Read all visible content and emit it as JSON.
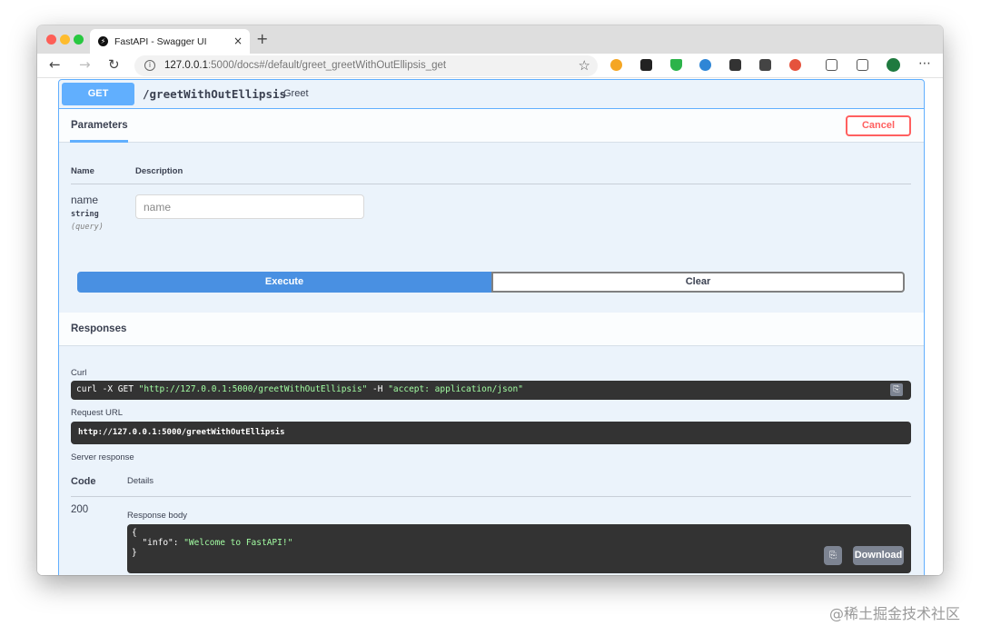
{
  "browser": {
    "tab_title": "FastAPI - Swagger UI",
    "tab_close": "×",
    "new_tab": "+",
    "url_host": "127.0.0.1",
    "url_rest": ":5000/docs#/default/greet_greetWithOutEllipsis_get",
    "nav": {
      "back": "←",
      "forward": "→",
      "reload": "↻"
    },
    "info_glyph": "i",
    "star": "☆",
    "menu": "⋯",
    "extensions": [
      {
        "name": "ext-orange-icon",
        "color": "#f5a623"
      },
      {
        "name": "ext-dark-icon",
        "color": "#222222"
      },
      {
        "name": "ext-shield-icon",
        "color": "#2cb34a"
      },
      {
        "name": "ext-blue-icon",
        "color": "#2f86d6"
      },
      {
        "name": "ext-notion-icon",
        "color": "#333333"
      },
      {
        "name": "ext-box-icon",
        "color": "#444444"
      },
      {
        "name": "ext-colorful-icon",
        "color": "#e5533d"
      },
      {
        "name": "favorites-icon",
        "color": "#555555"
      },
      {
        "name": "collections-icon",
        "color": "#555555"
      },
      {
        "name": "profile-avatar-icon",
        "color": "#1f7a3f"
      }
    ]
  },
  "operation": {
    "method": "GET",
    "path": "/greetWithOutEllipsis",
    "summary": "Greet"
  },
  "parameters": {
    "tab_label": "Parameters",
    "cancel_label": "Cancel",
    "col_name": "Name",
    "col_description": "Description",
    "param": {
      "name": "name",
      "type": "string",
      "in": "(query)",
      "placeholder": "name"
    },
    "execute_label": "Execute",
    "clear_label": "Clear"
  },
  "responses": {
    "title": "Responses",
    "curl_label": "Curl",
    "curl_cmd": "curl -X GET ",
    "curl_url": "\"http://127.0.0.1:5000/greetWithOutEllipsis\"",
    "curl_flag": " -H  ",
    "curl_header": "\"accept: application/json\"",
    "request_url_label": "Request URL",
    "request_url": "http://127.0.0.1:5000/greetWithOutEllipsis",
    "server_response_label": "Server response",
    "col_code": "Code",
    "col_details": "Details",
    "code": "200",
    "body_label": "Response body",
    "body_open": "{",
    "body_key": "  \"info\": ",
    "body_value": "\"Welcome to FastAPI!\"",
    "body_close": "}",
    "download_label": "Download",
    "copy_glyph": "⎘"
  },
  "watermark": "@稀土掘金技术社区",
  "colors": {
    "get_blue": "#61affe",
    "execute_blue": "#4990e2",
    "cancel_red": "#ff6060",
    "code_bg": "#333333",
    "string_green": "#a2fca2"
  }
}
